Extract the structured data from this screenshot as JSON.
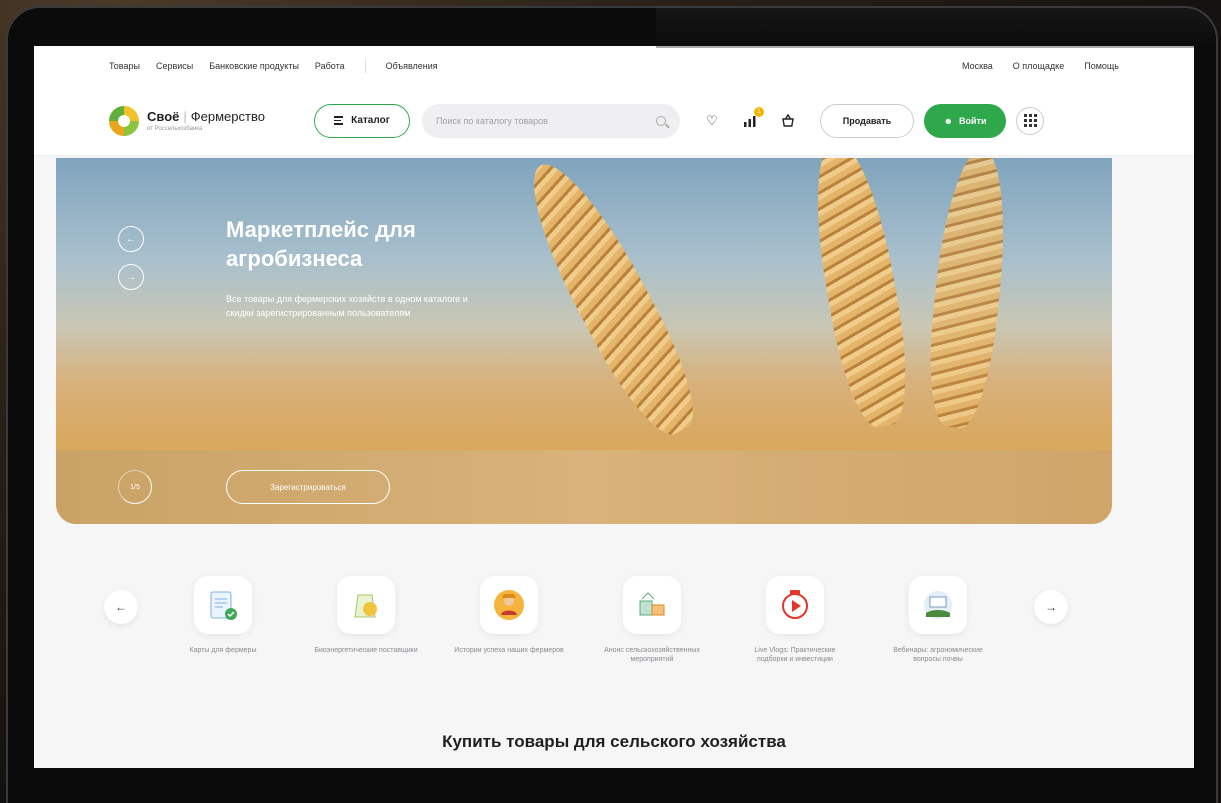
{
  "topnav": {
    "items": [
      "Товары",
      "Сервисы",
      "Банковские продукты",
      "Работа"
    ],
    "ads": "Объявления",
    "right": [
      "Москва",
      "О площадке",
      "Помощь"
    ]
  },
  "header": {
    "logo_name": "Своё",
    "logo_product": "Фермерство",
    "logo_sub": "от Россельхозбанка",
    "catalog_label": "Каталог",
    "search_placeholder": "Поиск по каталогу товаров",
    "cart_badge": "1",
    "sell_label": "Продавать",
    "login_label": "Войти"
  },
  "hero": {
    "title": "Маркетплейс для агробизнеса",
    "text": "Все товары для фермерских хозяйств в одном каталоге и скидки зарегистрированным пользователям",
    "register_label": "Зарегистрироваться",
    "counter": "1/5"
  },
  "services": [
    {
      "label": "Карты для фермеры",
      "icon": "map-card-icon"
    },
    {
      "label": "Биоэнергетические поставщики",
      "icon": "bio-bag-icon"
    },
    {
      "label": "Истории успеха наших фермеров",
      "icon": "farmer-icon"
    },
    {
      "label": "Анонс сельскохозяйственных мероприятий",
      "icon": "calendar-icon"
    },
    {
      "label": "Live Vlogs: Практические подборки и инвестиции",
      "icon": "video-icon"
    },
    {
      "label": "Вебинары: агрономические вопросы почвы",
      "icon": "webinar-icon"
    }
  ],
  "section_title": "Купить товары для сельского хозяйства",
  "colors": {
    "brand_green": "#2ea84a",
    "badge": "#f5b400"
  }
}
